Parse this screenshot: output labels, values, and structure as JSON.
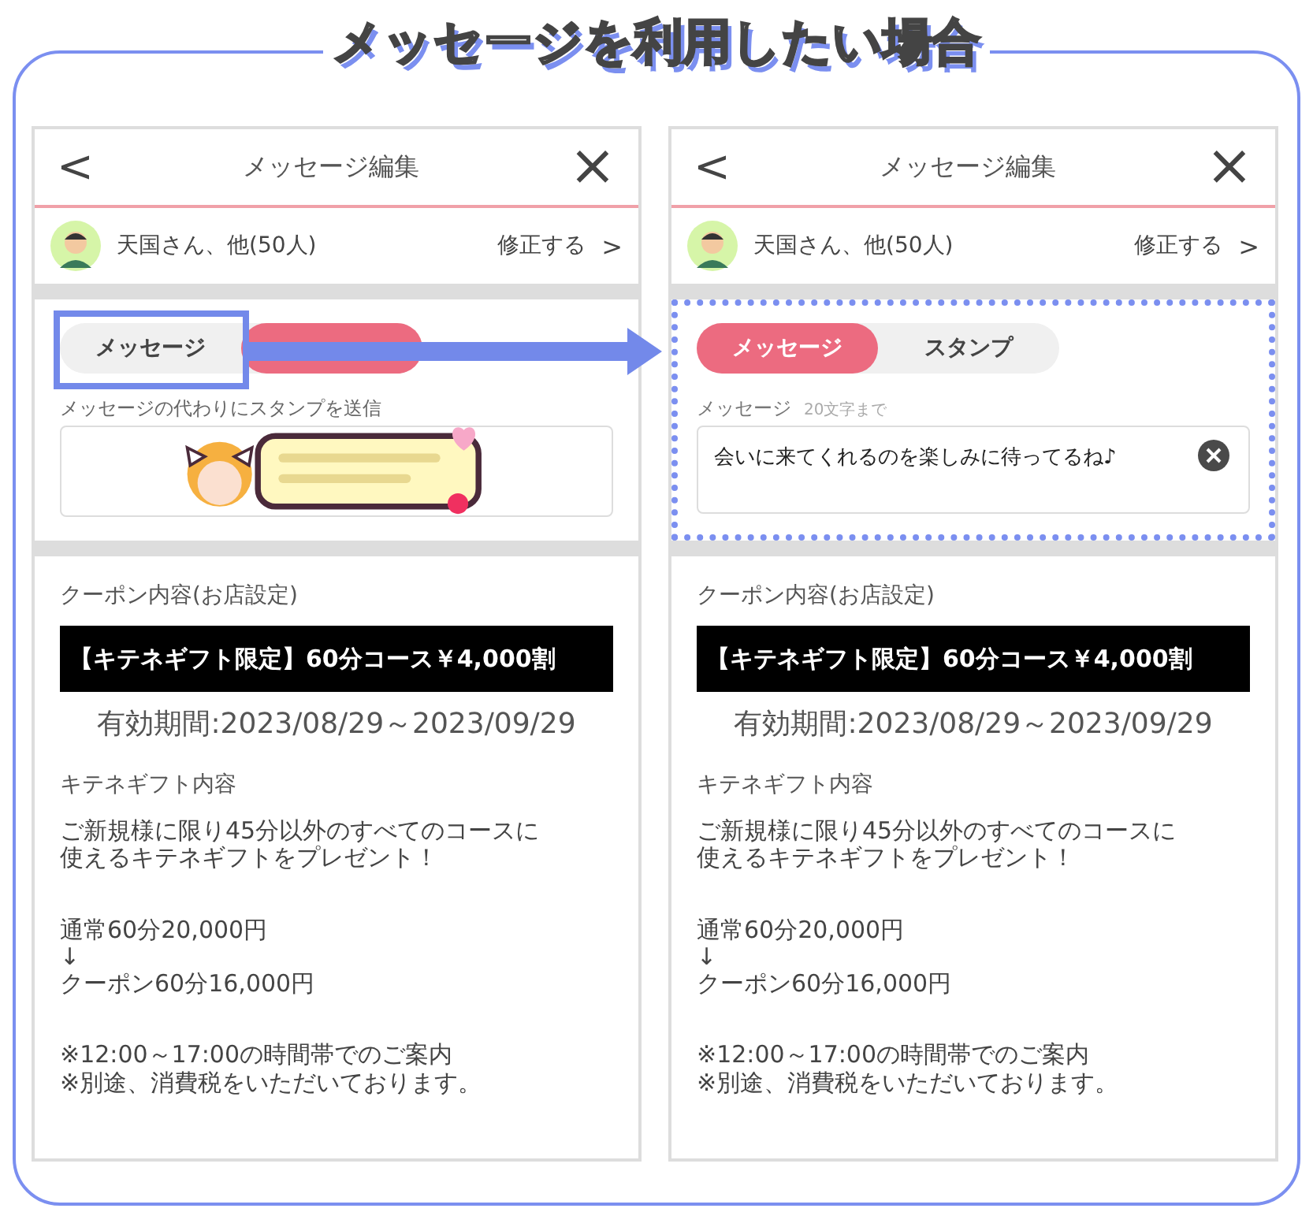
{
  "title": "メッセージを利用したい場合",
  "panels": [
    {
      "kind": "stamp",
      "highlight_tab": true,
      "highlight_section": false,
      "header": {
        "back": "<",
        "title": "メッセージ編集",
        "close": "×"
      },
      "recipients": {
        "text": "天国さん、他(50人)",
        "edit": "修正する",
        "chevron": ">"
      },
      "tabs": [
        {
          "label": "メッセージ",
          "selected": false
        },
        {
          "selected": true
        }
      ],
      "stamp_caption": "メッセージの代わりにスタンプを送信",
      "coupon": {
        "heading": "クーポン内容(お店設定)",
        "banner": "【キテネギフト限定】60分コース￥4,000割",
        "validity": "有効期間:2023/08/29～2023/09/29",
        "gift_heading": "キテネギフト内容",
        "description": [
          "ご新規様に限り45分以外のすべてのコースに",
          "使えるキテネギフトをプレゼント！"
        ],
        "prices": "通常60分20,000円\n↓\nクーポン60分16,000円",
        "notes": "※12:00～17:00の時間帯でのご案内\n※別途、消費税をいただいております。"
      }
    },
    {
      "kind": "message",
      "highlight_tab": false,
      "highlight_section": true,
      "header": {
        "back": "<",
        "title": "メッセージ編集",
        "close": "×"
      },
      "recipients": {
        "text": "天国さん、他(50人)",
        "edit": "修正する",
        "chevron": ">"
      },
      "tabs": [
        {
          "label": "メッセージ",
          "selected": true
        },
        {
          "label": "スタンプ",
          "selected": false
        }
      ],
      "message_label": "メッセージ",
      "message_hint": "20文字まで",
      "message_value": "会いに来てくれるのを楽しみに待ってるね♪",
      "coupon": {
        "heading": "クーポン内容(お店設定)",
        "banner": "【キテネギフト限定】60分コース￥4,000割",
        "validity": "有効期間:2023/08/29～2023/09/29",
        "gift_heading": "キテネギフト内容",
        "description": [
          "ご新規様に限り45分以外のすべてのコースに",
          "使えるキテネギフトをプレゼント！"
        ],
        "prices": "通常60分20,000円\n↓\nクーポン60分16,000円",
        "notes": "※12:00～17:00の時間帯でのご案内\n※別途、消費税をいただいております。"
      }
    }
  ]
}
